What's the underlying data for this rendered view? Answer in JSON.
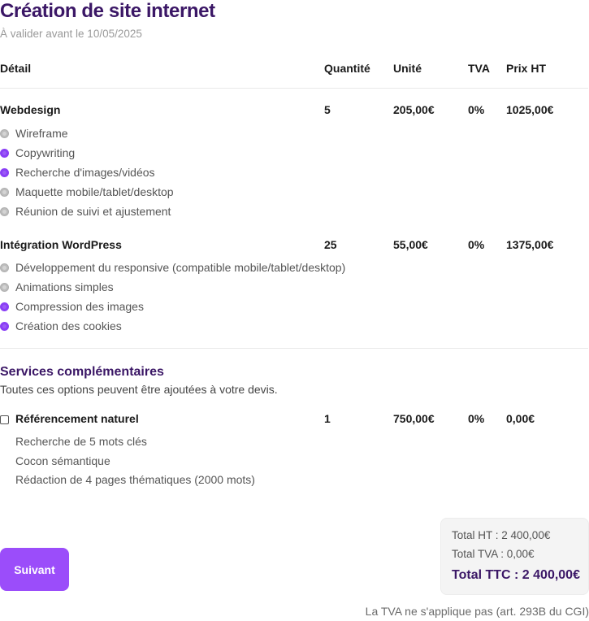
{
  "header": {
    "title": "Création de site internet",
    "subtitle": "À valider avant le 10/05/2025"
  },
  "table": {
    "columns": [
      "Détail",
      "Quantité",
      "Unité",
      "TVA",
      "Prix HT"
    ],
    "rows": [
      {
        "label": "Webdesign",
        "quantity": "5",
        "unit": "205,00€",
        "tva": "0%",
        "price": "1025,00€",
        "options": [
          {
            "label": "Wireframe",
            "checked": false
          },
          {
            "label": "Copywriting",
            "checked": true
          },
          {
            "label": "Recherche d'images/vidéos",
            "checked": true
          },
          {
            "label": "Maquette mobile/tablet/desktop",
            "checked": false
          },
          {
            "label": "Réunion de suivi et ajustement",
            "checked": false
          }
        ]
      },
      {
        "label": "Intégration WordPress",
        "quantity": "25",
        "unit": "55,00€",
        "tva": "0%",
        "price": "1375,00€",
        "options": [
          {
            "label": "Développement du responsive (compatible mobile/tablet/desktop)",
            "checked": false
          },
          {
            "label": "Animations simples",
            "checked": false
          },
          {
            "label": "Compression des images",
            "checked": true
          },
          {
            "label": "Création des cookies",
            "checked": true
          }
        ]
      }
    ]
  },
  "extras": {
    "title": "Services complémentaires",
    "subtitle": "Toutes ces options peuvent être ajoutées à votre devis.",
    "item": {
      "label": "Référencement naturel",
      "checked": false,
      "quantity": "1",
      "unit": "750,00€",
      "tva": "0%",
      "price": "0,00€",
      "details": [
        "Recherche de 5 mots clés",
        "Cocon sémantique",
        "Rédaction de 4 pages thématiques (2000 mots)"
      ]
    }
  },
  "totals": {
    "ht": "Total HT : 2 400,00€",
    "tva": "Total TVA : 0,00€",
    "ttc": "Total TTC : 2 400,00€"
  },
  "actions": {
    "next_label": "Suivant"
  },
  "footnote": "La TVA ne s'applique pas (art. 293B du CGI)",
  "colors": {
    "accent": "#9b4dfa",
    "title": "#3b1766",
    "unchecked": "#bdbdbd"
  },
  "icons": {
    "option_marker": "radio-dot-icon",
    "extra_toggle": "checkbox-icon"
  }
}
